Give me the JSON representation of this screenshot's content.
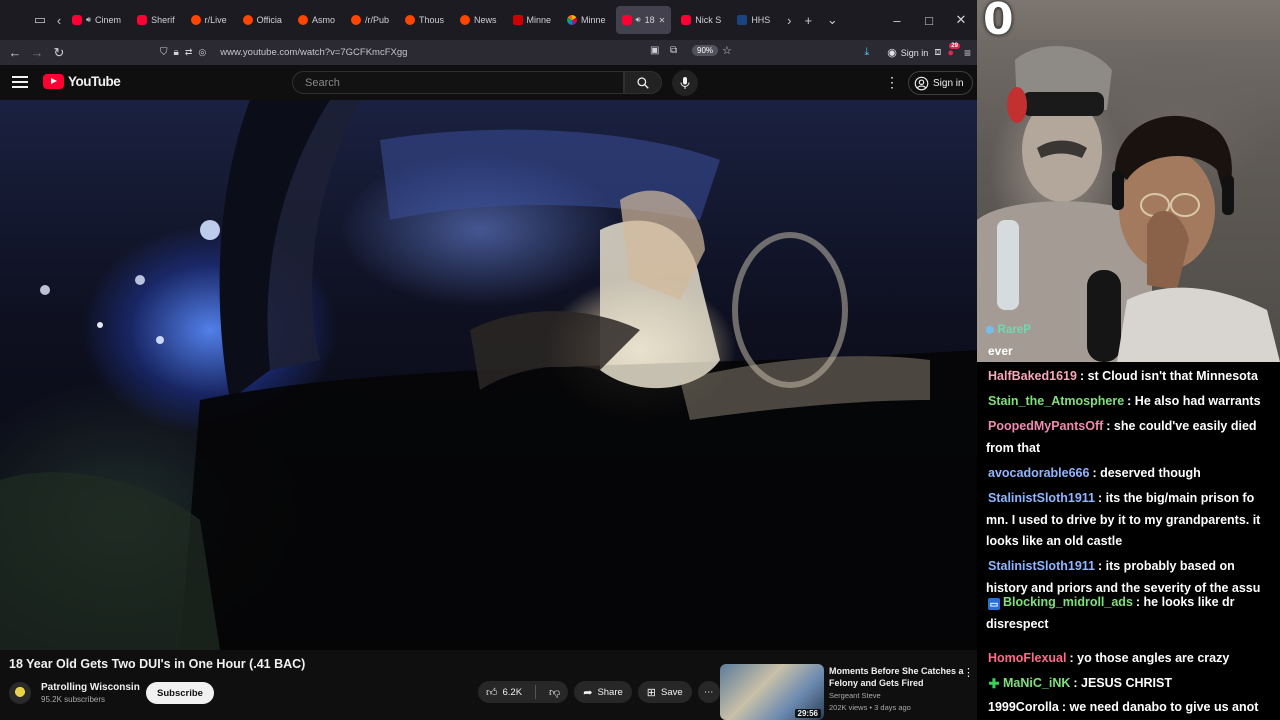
{
  "browser": {
    "tabs": [
      {
        "label": "Cinem",
        "fav": "yt",
        "audio": true
      },
      {
        "label": "Sherif",
        "fav": "yt"
      },
      {
        "label": "r/Live",
        "fav": "rd"
      },
      {
        "label": "Officia",
        "fav": "rd"
      },
      {
        "label": "Asmo",
        "fav": "rd"
      },
      {
        "label": "/r/Pub",
        "fav": "rd"
      },
      {
        "label": "Thous",
        "fav": "rd"
      },
      {
        "label": "News",
        "fav": "rd"
      },
      {
        "label": "Minne",
        "fav": "cnn"
      },
      {
        "label": "Minne",
        "fav": "nbc"
      },
      {
        "label": "18",
        "fav": "yt",
        "audio": true,
        "active": true
      },
      {
        "label": "Nick S",
        "fav": "yt"
      },
      {
        "label": "HHS",
        "fav": "hhs"
      }
    ],
    "url": "www.youtube.com/watch?v=7GCFKmcFXgg",
    "zoom": "90%",
    "signin_label": "Sign in",
    "notif_count": "29"
  },
  "youtube": {
    "logo_text": "YouTube",
    "search_placeholder": "Search",
    "signin_label": "Sign in",
    "video": {
      "title": "18 Year Old Gets Two DUI's in One Hour (.41 BAC)",
      "channel": "Patrolling Wisconsin",
      "subscribers": "95.2K subscribers",
      "subscribe_label": "Subscribe",
      "likes": "6.2K",
      "share_label": "Share",
      "save_label": "Save"
    },
    "recommendation": {
      "title": "Moments Before She Catches a Felony and Gets Fired",
      "channel": "Sergeant Steve",
      "meta": "202K views • 3 days ago",
      "duration": "29:56"
    }
  },
  "stream": {
    "corner_digit": "0",
    "cam_username": "RareP",
    "cam_message": "ever",
    "chat": [
      {
        "user": "HalfBaked1619",
        "color": "#f6a8b8",
        "text": ": st Cloud isn't that Minnesota",
        "cont": ""
      },
      {
        "user": "Stain_the_Atmosphere",
        "color": "#7ee07a",
        "text": ": He also had warrants",
        "cont": ""
      },
      {
        "user": "PoopedMyPantsOff",
        "color": "#f08ab0",
        "text": ": she could've easily died",
        "cont": "from that"
      },
      {
        "user": "avocadorable666",
        "color": "#8fb6ff",
        "text": ": deserved though",
        "cont": ""
      },
      {
        "user": "StalinistSloth1911",
        "color": "#8fb6ff",
        "text": ": its the big/main prison fo",
        "cont": "mn. I used to drive by it to my grandparents. it",
        "cont2": "looks like an old castle"
      },
      {
        "user": "StalinistSloth1911",
        "color": "#8fb6ff",
        "text": ": its probably based on",
        "cont": "history and priors and the severity of the assu"
      },
      {
        "user": "Blocking_midroll_ads",
        "color": "#7ee07a",
        "text": ": he looks like dr",
        "cont": "disrespect",
        "badge": "screen"
      },
      {
        "user": "HomoFlexual",
        "color": "#ff6b8b",
        "text": ": yo those angles are crazy",
        "cont": ""
      },
      {
        "user": "MaNiC_iNK",
        "color": "#7ee07a",
        "text": ": JESUS CHRIST",
        "cont": "",
        "badge": "plus"
      },
      {
        "user": "1999Corolla",
        "color": "#ffffff",
        "text": ": we need danabo to give us anot",
        "cont": ""
      }
    ]
  }
}
